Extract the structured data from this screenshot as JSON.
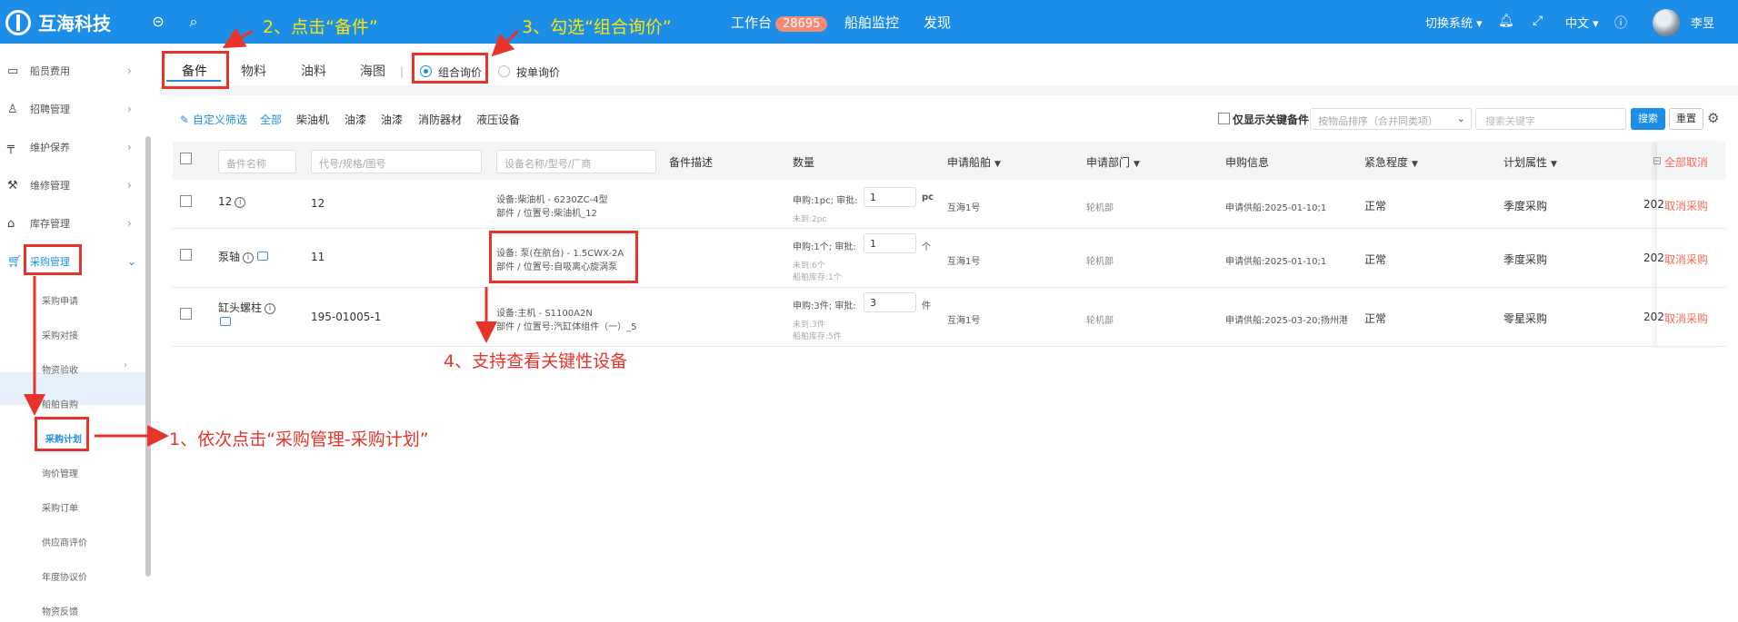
{
  "header": {
    "logo_text": "互海科技",
    "nav_workbench": "工作台",
    "workbench_count": "28695",
    "nav_ship_monitor": "船舶监控",
    "nav_discover": "发现",
    "switch_system": "切换系统",
    "language": "中文",
    "user_name": "李昱"
  },
  "sidebar": {
    "items": [
      {
        "label": "船员费用"
      },
      {
        "label": "招聘管理"
      },
      {
        "label": "维护保养"
      },
      {
        "label": "维修管理"
      },
      {
        "label": "库存管理"
      },
      {
        "label": "采购管理"
      }
    ],
    "sub_items": [
      {
        "label": "采购申请"
      },
      {
        "label": "采购对接"
      },
      {
        "label": "物资验收"
      },
      {
        "label": "船舶自购"
      },
      {
        "label": "采购计划"
      },
      {
        "label": "询价管理"
      },
      {
        "label": "采购订单"
      },
      {
        "label": "供应商评价"
      },
      {
        "label": "年度协议价"
      },
      {
        "label": "物资反馈"
      }
    ]
  },
  "tabs": [
    "备件",
    "物料",
    "油料",
    "海图"
  ],
  "inquiry": {
    "combined": "组合询价",
    "single": "按单询价"
  },
  "filters": {
    "custom": "自定义筛选",
    "all": "全部",
    "categories": [
      "柴油机",
      "油漆",
      "油漆",
      "消防器材",
      "液压设备"
    ],
    "key_only": "仅显示关键备件",
    "sort_placeholder": "按物品排序（合并同类项）",
    "search_placeholder": "搜索关键字",
    "search_btn": "搜索",
    "reset_btn": "重置"
  },
  "table": {
    "inputs": {
      "name": "备件名称",
      "code": "代号/规格/图号",
      "equip": "设备名称/型号/厂商"
    },
    "headers": {
      "desc": "备件描述",
      "qty": "数量",
      "ship": "申请船舶",
      "dept": "申请部门",
      "purchase": "申购信息",
      "urgency": "紧急程度",
      "plan": "计划属性",
      "cancel_all": "全部取消"
    },
    "rows": [
      {
        "name": "12",
        "code": "12",
        "equip_line1": "设备:柴油机 - 6230ZC-4型",
        "equip_line2": "部件 / 位置号:柴油机_12",
        "qty_label": "申购:1pc; 审批:",
        "qty_value": "1",
        "qty_unit": "pc",
        "sub1": "未到:2pc",
        "sub2": "",
        "ship": "互海1号",
        "dept": "轮机部",
        "purchase": "申请供船:2025-01-10;1",
        "urgency": "正常",
        "plan": "季度采购",
        "year": "202",
        "action": "取消采购"
      },
      {
        "name": "泵轴",
        "code": "11",
        "equip_line1": "设备: 泵(在航台) - 1.5CWX-2A",
        "equip_line2": "部件 / 位置号:自吸离心旋涡泵",
        "qty_label": "申购:1个; 审批:",
        "qty_value": "1",
        "qty_unit": "个",
        "sub1": "未到:6个",
        "sub2": "船舶库存:1个",
        "ship": "互海1号",
        "dept": "轮机部",
        "purchase": "申请供船:2025-01-10;1",
        "urgency": "正常",
        "plan": "季度采购",
        "year": "202",
        "action": "取消采购"
      },
      {
        "name": "缸头螺柱",
        "code": "195-01005-1",
        "equip_line1": "设备:主机 - S1100A2N",
        "equip_line2": "部件 / 位置号:汽缸体组件（一）_5",
        "qty_label": "申购:3件; 审批:",
        "qty_value": "3",
        "qty_unit": "件",
        "sub1": "未到:3件",
        "sub2": "船舶库存:5件",
        "ship": "互海1号",
        "dept": "轮机部",
        "purchase": "申请供船:2025-03-20;扬州港",
        "urgency": "正常",
        "plan": "零星采购",
        "year": "202",
        "action": "取消采购"
      }
    ]
  },
  "annotations": {
    "step1": "1、依次点击“采购管理-采购计划”",
    "step2": "2、点击“备件”",
    "step3": "3、勾选“组合询价”",
    "step4": "4、支持查看关键性设备"
  }
}
